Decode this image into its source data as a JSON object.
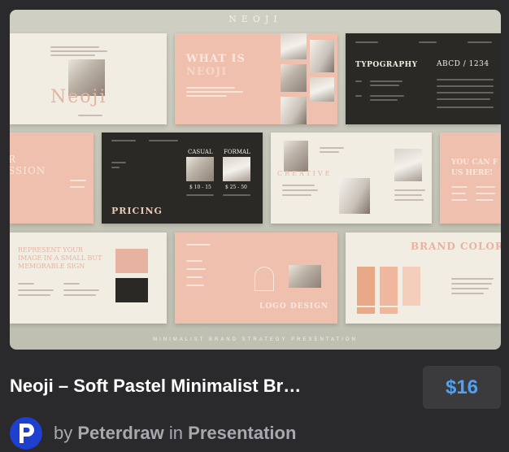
{
  "preview": {
    "brand": "NEOJI",
    "caption": "MINIMALIST BRAND STRATEGY PRESENTATION",
    "slides": {
      "cover_logo": "Neoji",
      "what_is": "WHAT IS",
      "what_is_sub": "NEOJI",
      "typography": "TYPOGRAPHY",
      "typography_sample": "ABCD / 1234",
      "ession": "SSION",
      "ession_r": "R",
      "pricing": "PRICING",
      "casual": "CASUAL",
      "formal": "FORMAL",
      "price_casual": "$ 10 - 15",
      "price_formal": "$ 25 - 50",
      "creative": "CREATIVE",
      "you_can_find": "YOU CAN F",
      "us_here": "US HERE!",
      "represent": "REPRESENT YOUR",
      "represent2": "IMAGE IN A SMALL BUT",
      "represent3": "MEMORABLE SIGN",
      "logo_design": "LOGO DESIGN",
      "brand_color": "BRAND COLOR"
    }
  },
  "product": {
    "title": "Neoji – Soft Pastel Minimalist Br…",
    "price": "$16",
    "by": "by",
    "author": "Peterdraw",
    "in": "in",
    "category": "Presentation"
  },
  "colors": {
    "accent": "#4ea1f3",
    "peach": "#efc0ad",
    "cream": "#f1ede3",
    "dark": "#2b2925",
    "avatar_bg": "#1f3fd0"
  },
  "icons": {
    "avatar": "peterdraw-p-logo"
  }
}
